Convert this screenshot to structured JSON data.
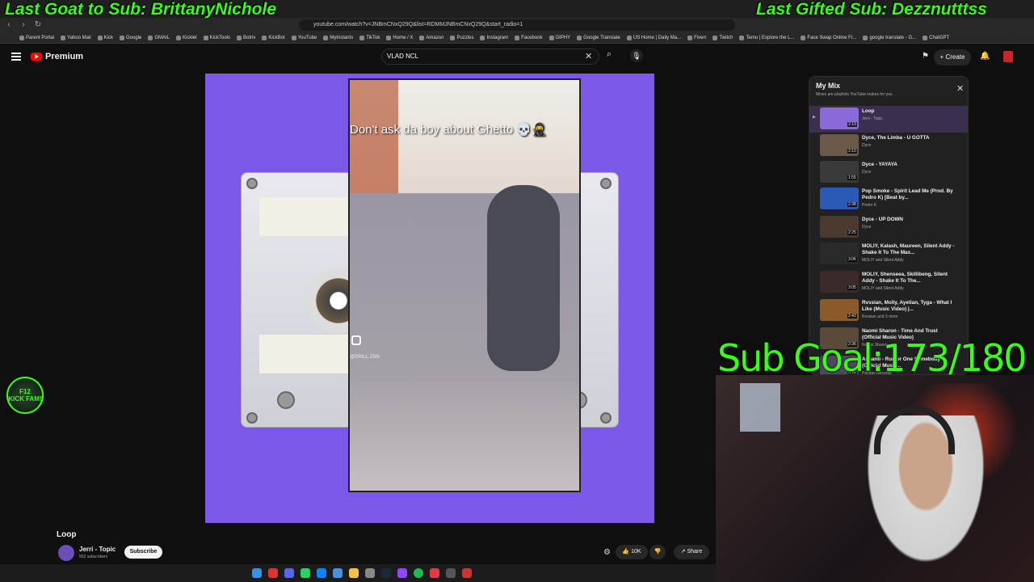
{
  "overlay": {
    "last_goat": "Last Goat to Sub: BrittanyNichole",
    "last_gifted": "Last Gifted Sub: Dezznutttss",
    "sub_goal": "Sub Goal:173/180"
  },
  "browser": {
    "url": "youtube.com/watch?v=JNBmCNxQ29Q&list=RDMMJNBmCNxQ29Q&start_radio=1",
    "bookmarks": [
      "Parent Portal",
      "Yahoo Mail",
      "Kick",
      "Google",
      "GMAIL",
      "Kicklet",
      "KickTools",
      "Botrix",
      "KickBot",
      "YouTube",
      "MyInstants",
      "TikTok",
      "Home / X",
      "Amazon",
      "Puzzles",
      "Instagram",
      "Facebook",
      "GIPHY",
      "Google Translate",
      "US Home | Daily Ma...",
      "Fiverr",
      "Twitch",
      "Temu | Explore the L...",
      "Face Swap Online Fr...",
      "google translate - G...",
      "ChatGPT"
    ]
  },
  "masthead": {
    "brand": "Premium",
    "search_value": "VLAD NCL",
    "create_label": "Create"
  },
  "player": {
    "caption": "Don't ask da boy about Ghetto 💀🥷",
    "watermark": "@DRILL.ZSN"
  },
  "video": {
    "title": "Loop",
    "channel": "Jerri - Topic",
    "subscribers": "552 subscribers",
    "subscribe_label": "Subscribe",
    "likes": "10K",
    "share_label": "Share"
  },
  "mix": {
    "title": "My Mix",
    "subtitle": "Mixes are playlists YouTube makes for you",
    "items": [
      {
        "title": "Loop",
        "artist": "Jerri - Topic",
        "duration": "2:19",
        "color": "#8a6ad8"
      },
      {
        "title": "Dyce, The Limba - U GOTTA",
        "artist": "Dyce",
        "duration": "2:10",
        "color": "#6b5a4a"
      },
      {
        "title": "Dyce - YAYAYA",
        "artist": "Dyce",
        "duration": "1:55",
        "color": "#3a3a3a"
      },
      {
        "title": "Pop Smoke - Spirit Lead Me (Prod. By Pedro K) [Beat by...",
        "artist": "Pedro K",
        "duration": "2:38",
        "color": "#2a5ab5"
      },
      {
        "title": "Dyce - UP DOWN",
        "artist": "Dyce",
        "duration": "2:25",
        "color": "#4a3a30"
      },
      {
        "title": "MOLIY, Kalash, Maureen, Silent Addy - Shake It To The Max...",
        "artist": "MOLIY and Silent Addy",
        "duration": "3:06",
        "color": "#2a2a2a"
      },
      {
        "title": "MOLIY, Shenseea, Skillibeng, Silent Addy - Shake It To The...",
        "artist": "MOLIY and Silent Addy",
        "duration": "3:05",
        "color": "#3a2a2a"
      },
      {
        "title": "Rvssian, Molly, Ayetian, Tyga - What I Like (Music Video) |...",
        "artist": "Rvssian and 3 more",
        "duration": "2:42",
        "color": "#8a5a2a"
      },
      {
        "title": "Naomi Sharon - Time And Trust (Official Music Video)",
        "artist": "Naomi Sharon",
        "duration": "2:36",
        "color": "#5a4a3a"
      },
      {
        "title": "Ashanti - Rumor One Somebody (Official Music...",
        "artist": "Payday Records",
        "duration": "3:16",
        "color": "#4a4a5a"
      }
    ]
  },
  "badge": {
    "line1": "F12",
    "line2": "KICK FAM!"
  }
}
